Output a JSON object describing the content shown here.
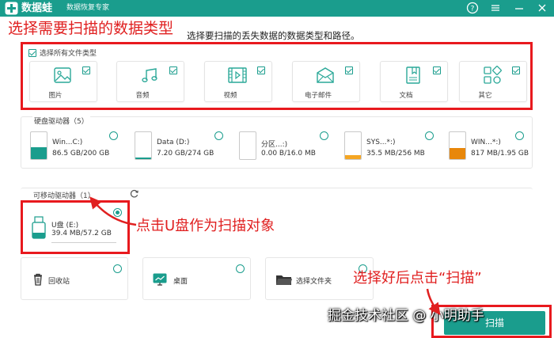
{
  "app": {
    "name": "数据蛙",
    "subtitle": "数据恢复专家"
  },
  "annotations": {
    "choose_types": "选择需要扫描的数据类型",
    "click_udisk": "点击U盘作为扫描对象",
    "after_select": "选择好后点击“扫描”"
  },
  "instruction": "选择要扫描的丢失数据的数据类型和路径。",
  "file_types": {
    "select_all_label": "选择所有文件类型",
    "items": [
      {
        "label": "图片",
        "icon": "image-icon"
      },
      {
        "label": "音频",
        "icon": "audio-icon"
      },
      {
        "label": "视频",
        "icon": "video-icon"
      },
      {
        "label": "电子邮件",
        "icon": "email-icon"
      },
      {
        "label": "文档",
        "icon": "document-icon"
      },
      {
        "label": "其它",
        "icon": "other-icon"
      }
    ]
  },
  "hard_drives": {
    "title": "硬盘驱动器（5）",
    "items": [
      {
        "name": "Win...C:)",
        "size": "86.5 GB/200 GB",
        "used": 0.43,
        "color": "#1a9d8d"
      },
      {
        "name": "Data (D:)",
        "size": "7.20 GB/274 GB",
        "used": 0.03,
        "color": "#1a9d8d"
      },
      {
        "name": "分区...:)",
        "size": "0.00  B/16.0 MB",
        "used": 0.0,
        "color": "#1a9d8d"
      },
      {
        "name": "SYS...*:)",
        "size": "35.5 MB/256 MB",
        "used": 0.14,
        "color": "#f5a623"
      },
      {
        "name": "WIN...*:)",
        "size": "817 MB/1.95 GB",
        "used": 0.42,
        "color": "#e8870a"
      }
    ]
  },
  "removable": {
    "title": "可移动驱动器（1）",
    "item": {
      "name": "U盘 (E:)",
      "size": "39.4 MB/57.2 GB",
      "used": 0.001,
      "color": "#1a9d8d"
    }
  },
  "locations": [
    {
      "label": "回收站",
      "icon": "recycle-bin-icon"
    },
    {
      "label": "桌面",
      "icon": "desktop-icon"
    },
    {
      "label": "选择文件夹",
      "icon": "folder-icon"
    }
  ],
  "scan_button": "扫描",
  "watermark": "掘金技术社区 @ 小明助手",
  "colors": {
    "brand": "#1a9d8d",
    "annotation": "#e8191e"
  }
}
